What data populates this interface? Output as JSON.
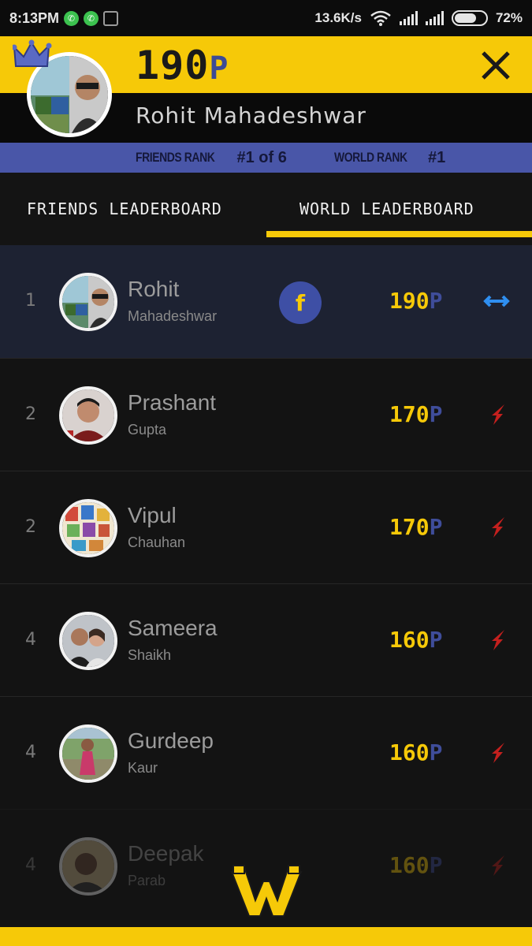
{
  "status_bar": {
    "time": "8:13PM",
    "speed": "13.6K/s",
    "battery": "72%",
    "battery_level": 0.72,
    "icons": [
      "whatsapp-icon",
      "whatsapp-icon",
      "gallery-icon",
      "wifi-icon",
      "signal-icon",
      "signal-icon",
      "battery-icon"
    ]
  },
  "header": {
    "points_value": "190",
    "points_unit": "P",
    "user_name": "Rohit Mahadeshwar",
    "close_icon": "close-icon",
    "crown_icon": "crown-icon"
  },
  "ranks": {
    "friends_label": "FRIENDS RANK",
    "friends_value": "#1 of 6",
    "world_label": "WORLD RANK",
    "world_value": "#1"
  },
  "tabs": {
    "friends": "FRIENDS LEADERBOARD",
    "world": "WORLD LEADERBOARD",
    "active": "world"
  },
  "leaderboard": [
    {
      "rank": "1",
      "first": "Rohit",
      "last": "Mahadeshwar",
      "points": "190",
      "unit": "P",
      "facebook": "f",
      "trend": "same"
    },
    {
      "rank": "2",
      "first": "Prashant",
      "last": "Gupta",
      "points": "170",
      "unit": "P",
      "trend": "down"
    },
    {
      "rank": "2",
      "first": "Vipul",
      "last": "Chauhan",
      "points": "170",
      "unit": "P",
      "trend": "down"
    },
    {
      "rank": "4",
      "first": "Sameera",
      "last": "Shaikh",
      "points": "160",
      "unit": "P",
      "trend": "down"
    },
    {
      "rank": "4",
      "first": "Gurdeep",
      "last": "Kaur",
      "points": "160",
      "unit": "P",
      "trend": "down"
    },
    {
      "rank": "4",
      "first": "Deepak",
      "last": "Parab",
      "points": "160",
      "unit": "P",
      "trend": "down"
    }
  ],
  "colors": {
    "accent_yellow": "#f6c908",
    "rank_bar_blue": "#4956a8",
    "trend_same": "#2f8ff0",
    "trend_down": "#c4201e"
  },
  "footer": {
    "logo_icon": "w-logo-icon"
  }
}
